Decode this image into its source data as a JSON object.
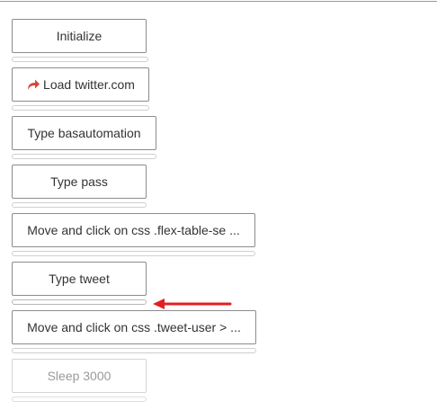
{
  "steps": [
    {
      "label": "Initialize",
      "progress": 0,
      "enabled": true
    },
    {
      "label": "Load twitter.com",
      "icon": "share-arrow-icon",
      "progress": 0,
      "enabled": true
    },
    {
      "label": "Type basautomation",
      "progress": 0,
      "enabled": true
    },
    {
      "label": "Type pass",
      "progress": 0,
      "enabled": true
    },
    {
      "label": "Move and click on css .flex-table-se ...",
      "progress": 0,
      "enabled": true
    },
    {
      "label": "Type tweet",
      "progress": 0,
      "enabled": true,
      "current": true
    },
    {
      "label": "Move and click on css .tweet-user > ...",
      "progress": 0,
      "enabled": true
    },
    {
      "label": "Sleep 3000",
      "progress": 0,
      "enabled": false
    }
  ],
  "annotation": {
    "icon": "arrow-left-icon",
    "color": "#e02020"
  },
  "colors": {
    "icon": "#d9453a",
    "border": "#8c8c8c",
    "text": "#333333"
  }
}
